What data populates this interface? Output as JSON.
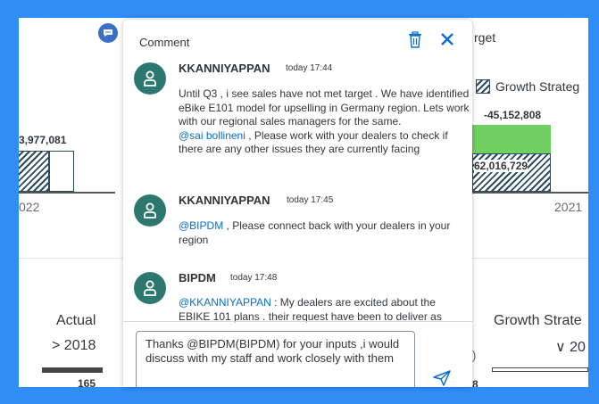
{
  "background": {
    "title_fragment": "rget",
    "legend_label": "Growth Strateg",
    "value_left": "3,977,081",
    "value_right_top": "-45,152,808",
    "value_right_bar": "62,016,729",
    "year_left": "022",
    "year_right": "2021",
    "actual_label": "Actual",
    "actual_year": "> 2018",
    "growth_label": "Growth Strate",
    "growth_year": "∨ 20",
    "small_value_left": "165",
    "small_value_right": "8",
    "paren_fragment": "9)"
  },
  "panel": {
    "title": "Comment",
    "messages": [
      {
        "author": "KKANNIYAPPAN",
        "time": "today 17:44",
        "text": "Until Q3 , i see sales have not met target . We have identified eBike E101 model for upselling in Germany region. Lets work with our regional sales managers for the same.",
        "mention": "@sai bollineni",
        "mention_text": " , Please work with your dealers to check if there are any other issues they are currently facing"
      },
      {
        "author": "KKANNIYAPPAN",
        "time": "today 17:45",
        "mention": "@BIPDM",
        "mention_text": " , Please connect back with your dealers in your region"
      },
      {
        "author": "BIPDM",
        "time": "today 17:48",
        "mention": "@KKANNIYAPPAN",
        "mention_text": " : My dealers are excited about the EBIKE 101 plans . their request have been to deliver as"
      }
    ],
    "composer_value": "Thanks @BIPDM(BIPDM) for your inputs ,i would discuss with my staff and work closely with them"
  },
  "colors": {
    "frame_border": "#2f8df5",
    "avatar": "#2c7870",
    "mention": "#0a6ed1",
    "green_bar": "#6fcf60",
    "hatch": "#2b4b63"
  }
}
